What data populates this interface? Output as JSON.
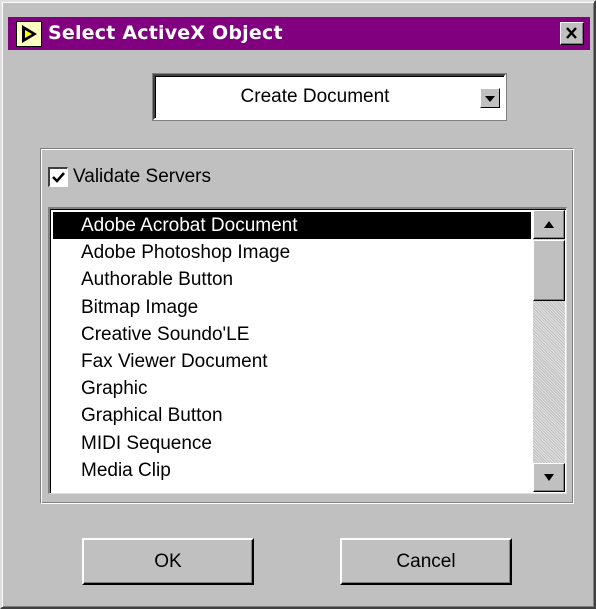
{
  "window": {
    "title": "Select ActiveX Object",
    "title_icon": "labview-vi-icon",
    "close_icon": "close-icon",
    "title_bar_color": "#800080"
  },
  "mode_select": {
    "value": "Create  Document",
    "arrow_icon": "chevron-down-icon"
  },
  "validate": {
    "label": "Validate Servers",
    "checked": true
  },
  "server_list": {
    "items": [
      "Adobe Acrobat Document",
      "Adobe Photoshop Image",
      "Authorable Button",
      "Bitmap Image",
      "Creative Soundo'LE",
      "Fax Viewer Document",
      "Graphic",
      "Graphical Button",
      "MIDI Sequence",
      "Media Clip"
    ],
    "selected_index": 0
  },
  "buttons": {
    "ok_label": "OK",
    "cancel_label": "Cancel"
  }
}
